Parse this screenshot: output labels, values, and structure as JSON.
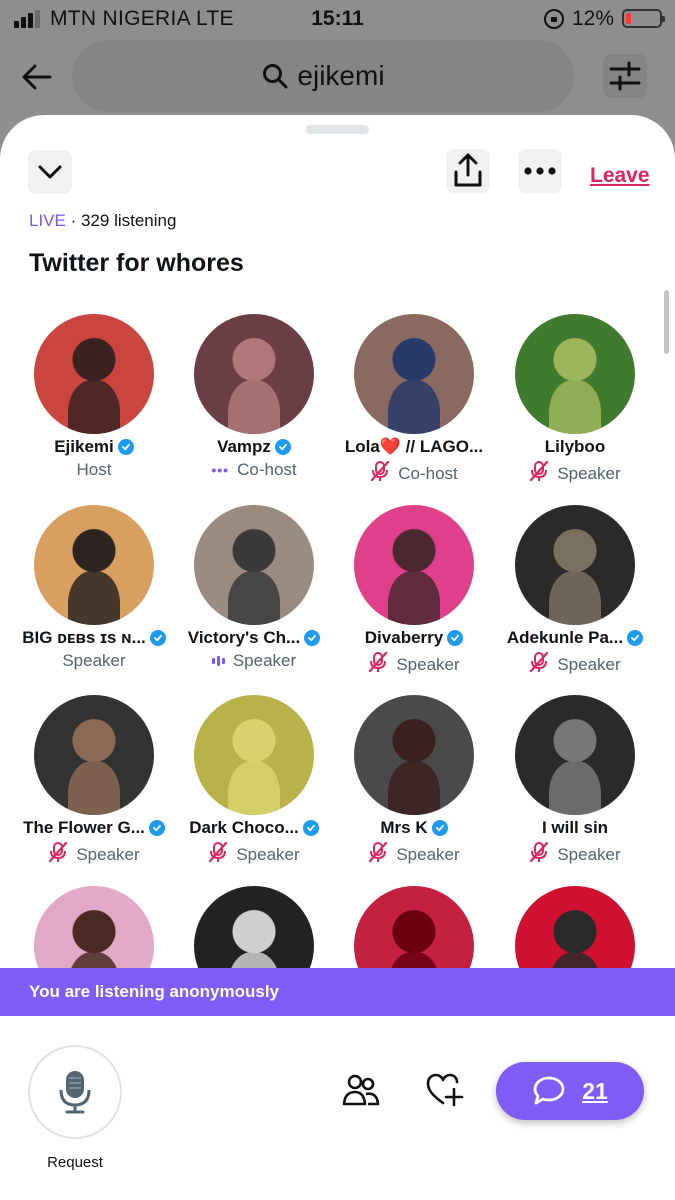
{
  "status_bar": {
    "carrier": "MTN NIGERIA  LTE",
    "time": "15:11",
    "battery": "12%",
    "battery_color": "#ff3b30"
  },
  "search": {
    "query": "ejikemi"
  },
  "space": {
    "live_label": "LIVE",
    "listening": "· 329 listening",
    "title": "Twitter for whores",
    "leave_label": "Leave"
  },
  "participants": [
    {
      "name": "Ejikemi",
      "verified": true,
      "role": "Host",
      "status": "none"
    },
    {
      "name": "Vampz",
      "verified": true,
      "role": "Co-host",
      "status": "dots"
    },
    {
      "name": "Lola❤️ // LAGO...",
      "verified": false,
      "role": "Co-host",
      "status": "muted"
    },
    {
      "name": "Lilyboo",
      "verified": false,
      "role": "Speaker",
      "status": "muted"
    },
    {
      "name": "BIG ᴅᴇʙs ɪs ɴ...",
      "verified": true,
      "role": "Speaker",
      "status": "none"
    },
    {
      "name": "Victory's Ch...",
      "verified": true,
      "role": "Speaker",
      "status": "speaking"
    },
    {
      "name": "Divaberry",
      "verified": true,
      "role": "Speaker",
      "status": "muted"
    },
    {
      "name": "Adekunle Pa...",
      "verified": true,
      "role": "Speaker",
      "status": "muted"
    },
    {
      "name": "The Flower G...",
      "verified": true,
      "role": "Speaker",
      "status": "muted"
    },
    {
      "name": "Dark Choco...",
      "verified": true,
      "role": "Speaker",
      "status": "muted"
    },
    {
      "name": "Mrs K",
      "verified": true,
      "role": "Speaker",
      "status": "muted"
    },
    {
      "name": "I will sin",
      "verified": false,
      "role": "Speaker",
      "status": "muted"
    },
    {
      "name": "",
      "verified": false,
      "role": "",
      "status": "none"
    },
    {
      "name": "",
      "verified": false,
      "role": "",
      "status": "none"
    },
    {
      "name": "",
      "verified": false,
      "role": "",
      "status": "none"
    },
    {
      "name": "",
      "verified": false,
      "role": "",
      "status": "none"
    }
  ],
  "avatar_colors": [
    [
      "#c9453e",
      "#3a2220"
    ],
    [
      "#6b3d45",
      "#b0787a"
    ],
    [
      "#8a6a60",
      "#283a6a"
    ],
    [
      "#3f7a2e",
      "#9db65b"
    ],
    [
      "#d8a060",
      "#2b2420"
    ],
    [
      "#9a8a80",
      "#3a3a3a"
    ],
    [
      "#e0408a",
      "#4a2a30"
    ],
    [
      "#2a2a2a",
      "#7a7060"
    ],
    [
      "#333333",
      "#8a6a55"
    ],
    [
      "#b8b24a",
      "#d6d36e"
    ],
    [
      "#4a4a4a",
      "#3a2020"
    ],
    [
      "#2a2a2a",
      "#777777"
    ],
    [
      "#e2a9c6",
      "#4a2a22"
    ],
    [
      "#222222",
      "#cfcfcf"
    ],
    [
      "#c42040",
      "#6a0010"
    ],
    [
      "#d01030",
      "#2a2a2a"
    ]
  ],
  "banner": {
    "text": "You are listening anonymously"
  },
  "bottom_bar": {
    "request_label": "Request",
    "chat_count": "21"
  },
  "colors": {
    "accent": "#7e5cf5",
    "verified": "#1d9bf0",
    "mute": "#e0245e",
    "leave": "#e0245e"
  }
}
